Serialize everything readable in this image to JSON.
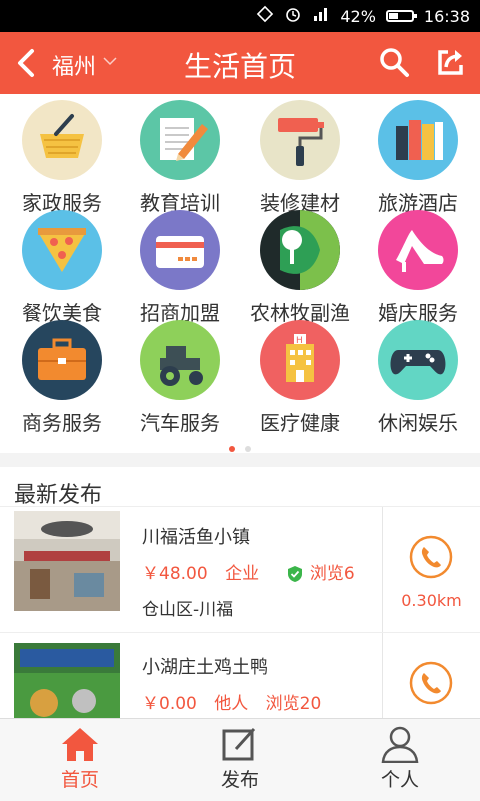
{
  "status_bar": {
    "battery": "42%",
    "time": "16:38",
    "battery_level": 0.42
  },
  "header": {
    "city": "福州",
    "title": "生活首页"
  },
  "categories": [
    {
      "label": "家政服务",
      "icon": "basket-icon",
      "color": "#f3e7c9"
    },
    {
      "label": "教育培训",
      "icon": "notepad-pencil-icon",
      "color": "#58c7a5"
    },
    {
      "label": "装修建材",
      "icon": "paint-roller-icon",
      "color": "#e9e5c9"
    },
    {
      "label": "旅游酒店",
      "icon": "books-icon",
      "color": "#5bc0e7"
    },
    {
      "label": "餐饮美食",
      "icon": "pizza-icon",
      "color": "#5bc0e7"
    },
    {
      "label": "招商加盟",
      "icon": "card-icon",
      "color": "#7a78c9"
    },
    {
      "label": "农林牧副渔",
      "icon": "tree-icon",
      "color": "#2e9f55"
    },
    {
      "label": "婚庆服务",
      "icon": "high-heel-icon",
      "color": "#f2479a"
    },
    {
      "label": "商务服务",
      "icon": "briefcase-icon",
      "color": "#26465e"
    },
    {
      "label": "汽车服务",
      "icon": "tractor-icon",
      "color": "#8ed05a"
    },
    {
      "label": "医疗健康",
      "icon": "hospital-icon",
      "color": "#f06161"
    },
    {
      "label": "休闲娱乐",
      "icon": "gamepad-icon",
      "color": "#62d6c4"
    }
  ],
  "section": {
    "title": "最新发布"
  },
  "listings": [
    {
      "name": "川福活鱼小镇",
      "price": "￥48.00",
      "type": "企业",
      "views": "浏览6",
      "location": "仓山区-川福",
      "distance": "0.30km"
    },
    {
      "name": "小湖庄土鸡土鸭",
      "price": "￥0.00",
      "type": "他人",
      "views": "浏览20",
      "location": "",
      "distance": ""
    }
  ],
  "tabs": {
    "home": "首页",
    "publish": "发布",
    "profile": "个人"
  },
  "colors": {
    "accent": "#f2573f"
  }
}
